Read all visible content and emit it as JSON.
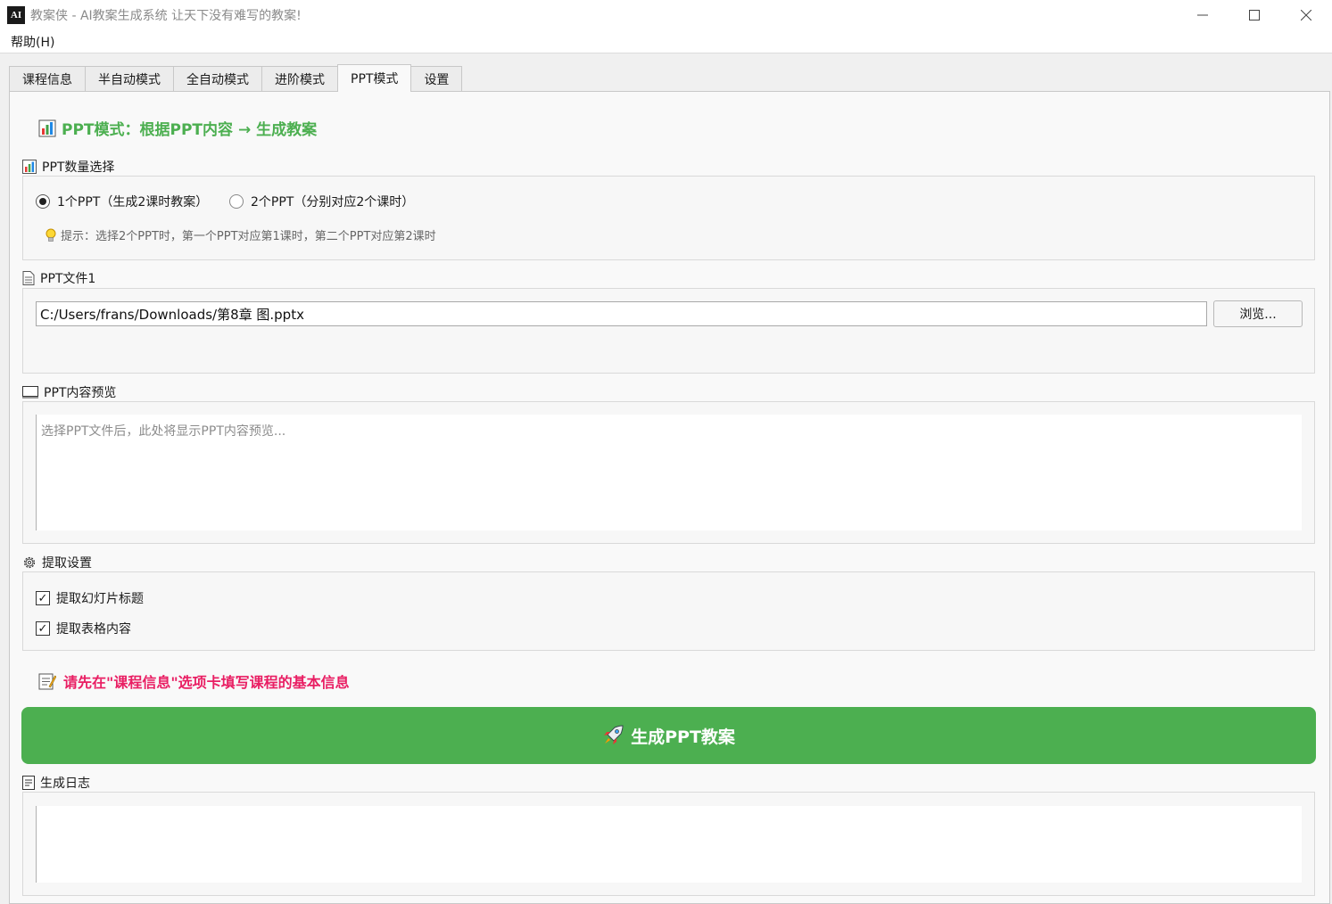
{
  "window": {
    "icon_text": "AI",
    "title": "教案侠 - AI教案生成系统   让天下没有难写的教案!"
  },
  "menu": {
    "help": "帮助(H)"
  },
  "tabs": [
    "课程信息",
    "半自动模式",
    "全自动模式",
    "进阶模式",
    "PPT模式",
    "设置"
  ],
  "active_tab": "PPT模式",
  "ppt_mode": {
    "title": "PPT模式：根据PPT内容 → 生成教案",
    "count_group": {
      "label": "PPT数量选择",
      "option1": "1个PPT（生成2课时教案）",
      "option2": "2个PPT（分别对应2个课时）",
      "selected": "1个PPT（生成2课时教案）",
      "hint": "提示：选择2个PPT时，第一个PPT对应第1课时，第二个PPT对应第2课时"
    },
    "file_group": {
      "label": "PPT文件1",
      "path": "C:/Users/frans/Downloads/第8章 图.pptx",
      "browse": "浏览..."
    },
    "preview_group": {
      "label": "PPT内容预览",
      "placeholder": "选择PPT文件后，此处将显示PPT内容预览..."
    },
    "extract_group": {
      "label": "提取设置",
      "titles": "提取幻灯片标题",
      "titles_checked": true,
      "tables": "提取表格内容",
      "tables_checked": true
    },
    "warning": "请先在\"课程信息\"选项卡填写课程的基本信息",
    "generate_button": "生成PPT教案",
    "log_group": {
      "label": "生成日志"
    }
  },
  "colors": {
    "accent_green": "#4caf50",
    "warning_pink": "#e91e63"
  },
  "icons": {
    "chart": "bar-chart-icon",
    "document": "document-icon",
    "monitor": "monitor-icon",
    "gear": "gear-icon",
    "memo": "memo-icon",
    "rocket": "rocket-icon",
    "bulb": "lightbulb-icon",
    "log": "log-icon"
  }
}
